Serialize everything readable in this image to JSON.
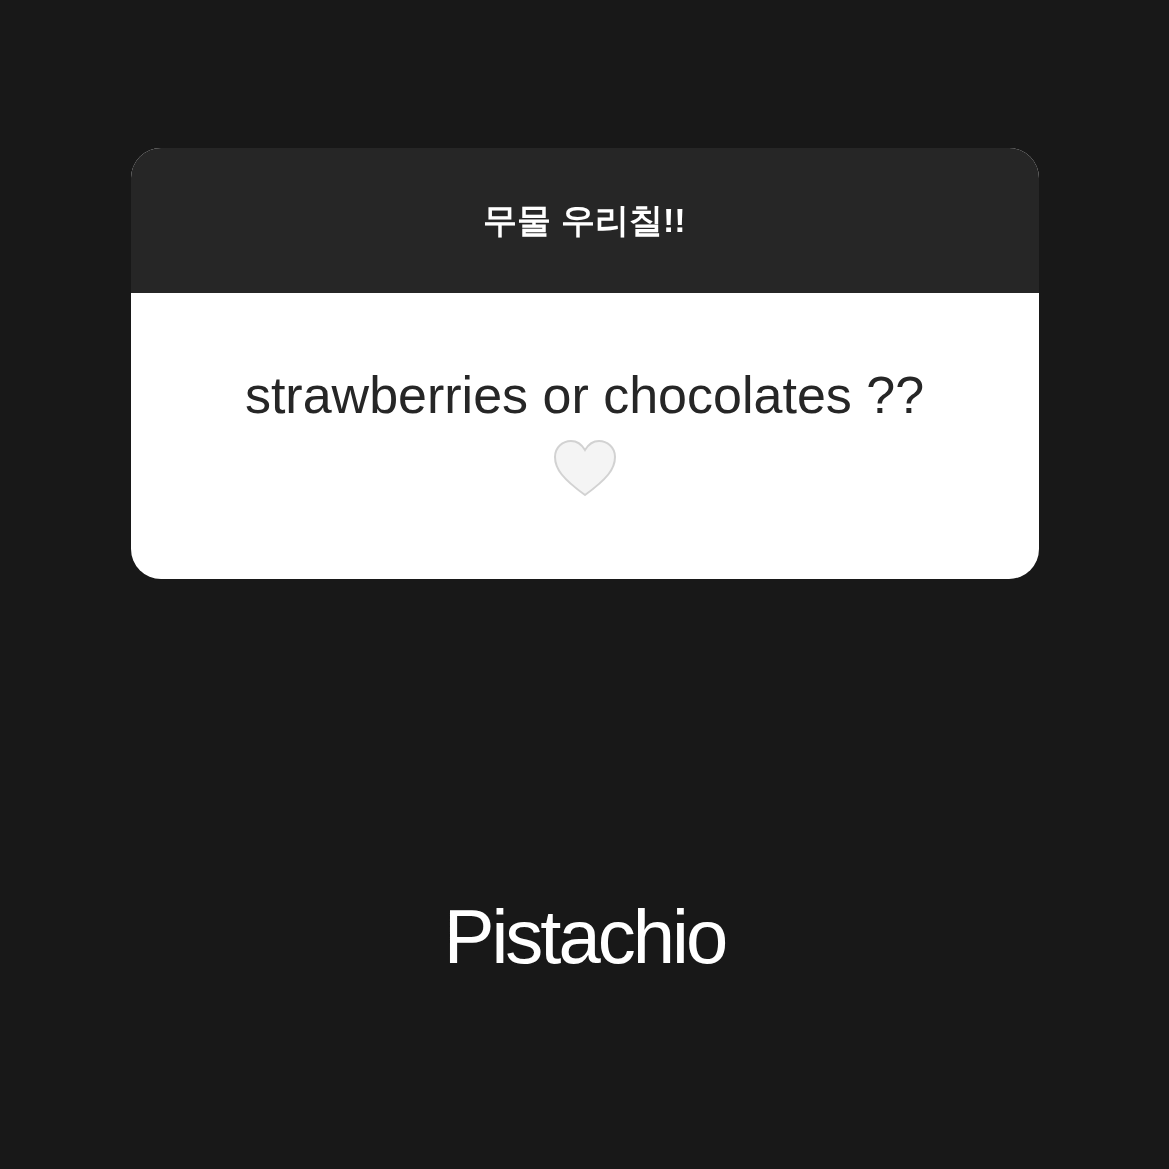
{
  "question_sticker": {
    "title": "무물 우리칠!!",
    "question": "strawberries or chocolates ??"
  },
  "answer": "Pistachio"
}
